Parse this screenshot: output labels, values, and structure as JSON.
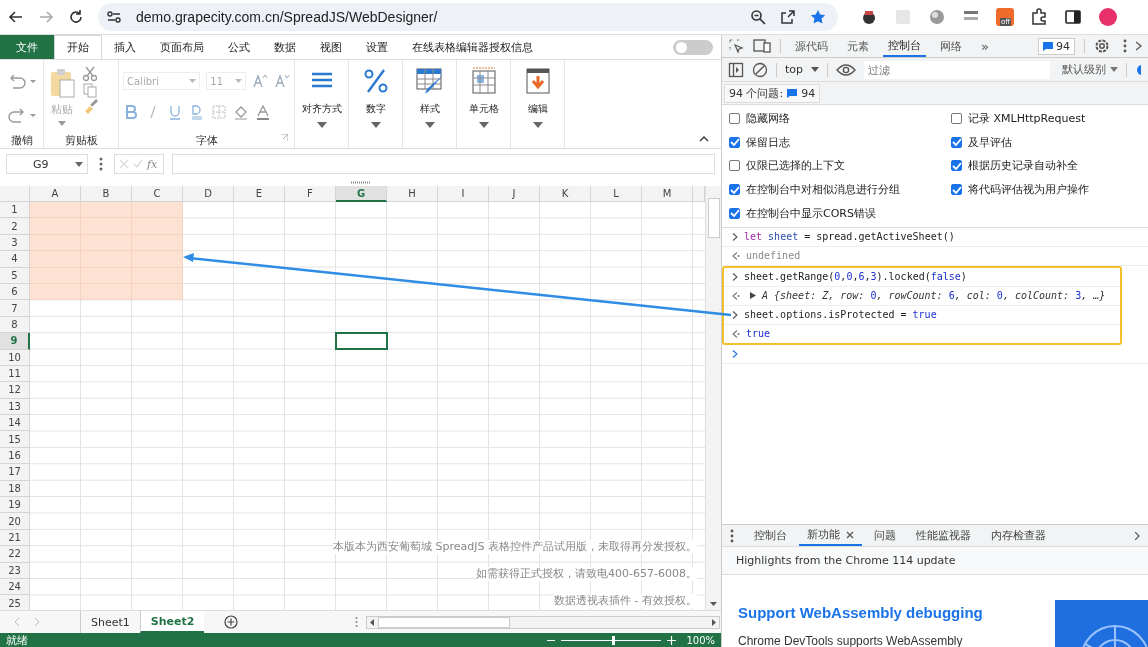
{
  "browser": {
    "url": "demo.grapecity.com.cn/SpreadJS/WebDesigner/",
    "extension_badge": "off"
  },
  "ribbon": {
    "tabs": [
      {
        "label": "文件",
        "kind": "file",
        "selected": false
      },
      {
        "label": "开始",
        "kind": "tab",
        "selected": true
      },
      {
        "label": "插入",
        "kind": "tab",
        "selected": false
      },
      {
        "label": "页面布局",
        "kind": "tab",
        "selected": false
      },
      {
        "label": "公式",
        "kind": "tab",
        "selected": false
      },
      {
        "label": "数据",
        "kind": "tab",
        "selected": false
      },
      {
        "label": "视图",
        "kind": "tab",
        "selected": false
      },
      {
        "label": "设置",
        "kind": "tab",
        "selected": false
      },
      {
        "label": "在线表格编辑器授权信息",
        "kind": "tab",
        "selected": false
      }
    ],
    "toggle_on": false,
    "undo_group": "撤销",
    "clipboard": {
      "paste": "粘贴",
      "group": "剪贴板"
    },
    "font": {
      "name": "Calibri",
      "size": "11",
      "group": "字体"
    },
    "big_buttons": [
      {
        "label": "对齐方式",
        "kind": "align"
      },
      {
        "label": "数字",
        "kind": "number"
      },
      {
        "label": "样式",
        "kind": "style"
      },
      {
        "label": "单元格",
        "kind": "cells"
      },
      {
        "label": "编辑",
        "kind": "edit"
      }
    ]
  },
  "formula_bar": {
    "name_box": "G9",
    "fx": "fx"
  },
  "grid": {
    "columns": [
      {
        "label": "A",
        "selected": false,
        "shaded": true
      },
      {
        "label": "B",
        "selected": false,
        "shaded": true
      },
      {
        "label": "C",
        "selected": false,
        "shaded": true
      },
      {
        "label": "D",
        "selected": false,
        "shaded": false
      },
      {
        "label": "E",
        "selected": false,
        "shaded": false
      },
      {
        "label": "F",
        "selected": false,
        "shaded": false
      },
      {
        "label": "G",
        "selected": true,
        "shaded": false
      },
      {
        "label": "H",
        "selected": false,
        "shaded": false
      },
      {
        "label": "I",
        "selected": false,
        "shaded": false
      },
      {
        "label": "J",
        "selected": false,
        "shaded": false
      },
      {
        "label": "K",
        "selected": false,
        "shaded": false
      },
      {
        "label": "L",
        "selected": false,
        "shaded": false
      },
      {
        "label": "M",
        "selected": false,
        "shaded": false
      }
    ],
    "rows": [
      {
        "label": "1",
        "selected": false,
        "shaded": true
      },
      {
        "label": "2",
        "selected": false,
        "shaded": true
      },
      {
        "label": "3",
        "selected": false,
        "shaded": true
      },
      {
        "label": "4",
        "selected": false,
        "shaded": true
      },
      {
        "label": "5",
        "selected": false,
        "shaded": true
      },
      {
        "label": "6",
        "selected": false,
        "shaded": true
      },
      {
        "label": "7",
        "selected": false,
        "shaded": false
      },
      {
        "label": "8",
        "selected": false,
        "shaded": false
      },
      {
        "label": "9",
        "selected": true,
        "shaded": false
      },
      {
        "label": "10",
        "selected": false,
        "shaded": false
      },
      {
        "label": "11",
        "selected": false,
        "shaded": false
      },
      {
        "label": "12",
        "selected": false,
        "shaded": false
      },
      {
        "label": "13",
        "selected": false,
        "shaded": false
      },
      {
        "label": "14",
        "selected": false,
        "shaded": false
      },
      {
        "label": "15",
        "selected": false,
        "shaded": false
      },
      {
        "label": "16",
        "selected": false,
        "shaded": false
      },
      {
        "label": "17",
        "selected": false,
        "shaded": false
      },
      {
        "label": "18",
        "selected": false,
        "shaded": false
      },
      {
        "label": "19",
        "selected": false,
        "shaded": false
      },
      {
        "label": "20",
        "selected": false,
        "shaded": false
      },
      {
        "label": "21",
        "selected": false,
        "shaded": false
      },
      {
        "label": "22",
        "selected": false,
        "shaded": false
      },
      {
        "label": "23",
        "selected": false,
        "shaded": false
      },
      {
        "label": "24",
        "selected": false,
        "shaded": false
      },
      {
        "label": "25",
        "selected": false,
        "shaded": false
      }
    ],
    "trial_notice": [
      "本版本为西安葡萄城 SpreadJS 表格控件产品试用版，未取得再分发授权。",
      "如需获得正式授权，请致电400-657-6008。",
      "数据透视表插件 - 有效授权。"
    ]
  },
  "sheet_tabs": [
    {
      "label": "Sheet1",
      "selected": false
    },
    {
      "label": "Sheet2",
      "selected": true
    }
  ],
  "status_bar": {
    "text": "就绪",
    "zoom": {
      "level": 0.52
    },
    "zoom_text": "100%"
  },
  "devtools": {
    "tabs": [
      {
        "label": "源代码",
        "selected": false
      },
      {
        "label": "元素",
        "selected": false
      },
      {
        "label": "控制台",
        "selected": true
      },
      {
        "label": "网络",
        "selected": false
      }
    ],
    "more": "»",
    "issues_badge": "94",
    "toolbar": {
      "context": "top",
      "filter_placeholder": "过滤",
      "level": "默认级别"
    },
    "issues": {
      "label": "94 个问题:",
      "count": "94"
    },
    "settings": [
      {
        "label": "隐藏网络",
        "checked": false
      },
      {
        "label": "记录 XMLHttpRequest",
        "checked": false
      },
      {
        "label": "保留日志",
        "checked": true
      },
      {
        "label": "及早评估",
        "checked": true
      },
      {
        "label": "仅限已选择的上下文",
        "checked": false
      },
      {
        "label": "根据历史记录自动补全",
        "checked": true
      },
      {
        "label": "在控制台中对相似消息进行分组",
        "checked": true
      },
      {
        "label": "将代码评估视为用户操作",
        "checked": true
      },
      {
        "label": "在控制台中显示CORS错误",
        "checked": true
      }
    ],
    "console": [
      {
        "kind": "input",
        "highlighted": false,
        "tokens": [
          {
            "text": "let ",
            "kind": "keyword"
          },
          {
            "text": "sheet",
            "kind": "variable"
          },
          {
            "text": " = spread.getActiveSheet()",
            "kind": "plain"
          }
        ]
      },
      {
        "kind": "output",
        "highlighted": false,
        "tokens": [
          {
            "text": "undefined",
            "kind": "muted"
          }
        ]
      },
      {
        "kind": "input",
        "highlighted": true,
        "tokens": [
          {
            "text": "sheet.getRange(",
            "kind": "plain"
          },
          {
            "text": "0",
            "kind": "number"
          },
          {
            "text": ",",
            "kind": "plain"
          },
          {
            "text": "0",
            "kind": "number"
          },
          {
            "text": ",",
            "kind": "plain"
          },
          {
            "text": "6",
            "kind": "number"
          },
          {
            "text": ",",
            "kind": "plain"
          },
          {
            "text": "3",
            "kind": "number"
          },
          {
            "text": ").locked(",
            "kind": "plain"
          },
          {
            "text": "false",
            "kind": "literal"
          },
          {
            "text": ")",
            "kind": "plain"
          }
        ]
      },
      {
        "kind": "object",
        "highlighted": true,
        "tokens": [
          {
            "text": "A {sheet: Z, row: ",
            "kind": "italic"
          },
          {
            "text": "0",
            "kind": "number"
          },
          {
            "text": ", rowCount: ",
            "kind": "italic"
          },
          {
            "text": "6",
            "kind": "number"
          },
          {
            "text": ", col: ",
            "kind": "italic"
          },
          {
            "text": "0",
            "kind": "number"
          },
          {
            "text": ", colCount: ",
            "kind": "italic"
          },
          {
            "text": "3",
            "kind": "number"
          },
          {
            "text": ", …}",
            "kind": "italic"
          }
        ]
      },
      {
        "kind": "input",
        "highlighted": true,
        "tokens": [
          {
            "text": "sheet.options.isProtected = ",
            "kind": "plain"
          },
          {
            "text": "true",
            "kind": "literal"
          }
        ]
      },
      {
        "kind": "output",
        "highlighted": true,
        "tokens": [
          {
            "text": "true",
            "kind": "literal"
          }
        ]
      },
      {
        "kind": "prompt",
        "highlighted": false
      }
    ],
    "drawer": {
      "tabs": [
        {
          "label": "控制台",
          "selected": false,
          "closable": false
        },
        {
          "label": "新功能",
          "selected": true,
          "closable": true
        },
        {
          "label": "问题",
          "selected": false,
          "closable": false
        },
        {
          "label": "性能监视器",
          "selected": false,
          "closable": false
        },
        {
          "label": "内存检查器",
          "selected": false,
          "closable": false
        }
      ],
      "subtitle": "Highlights from the Chrome 114 update",
      "heading": "Support WebAssembly debugging",
      "body": "Chrome DevTools supports WebAssembly"
    }
  }
}
